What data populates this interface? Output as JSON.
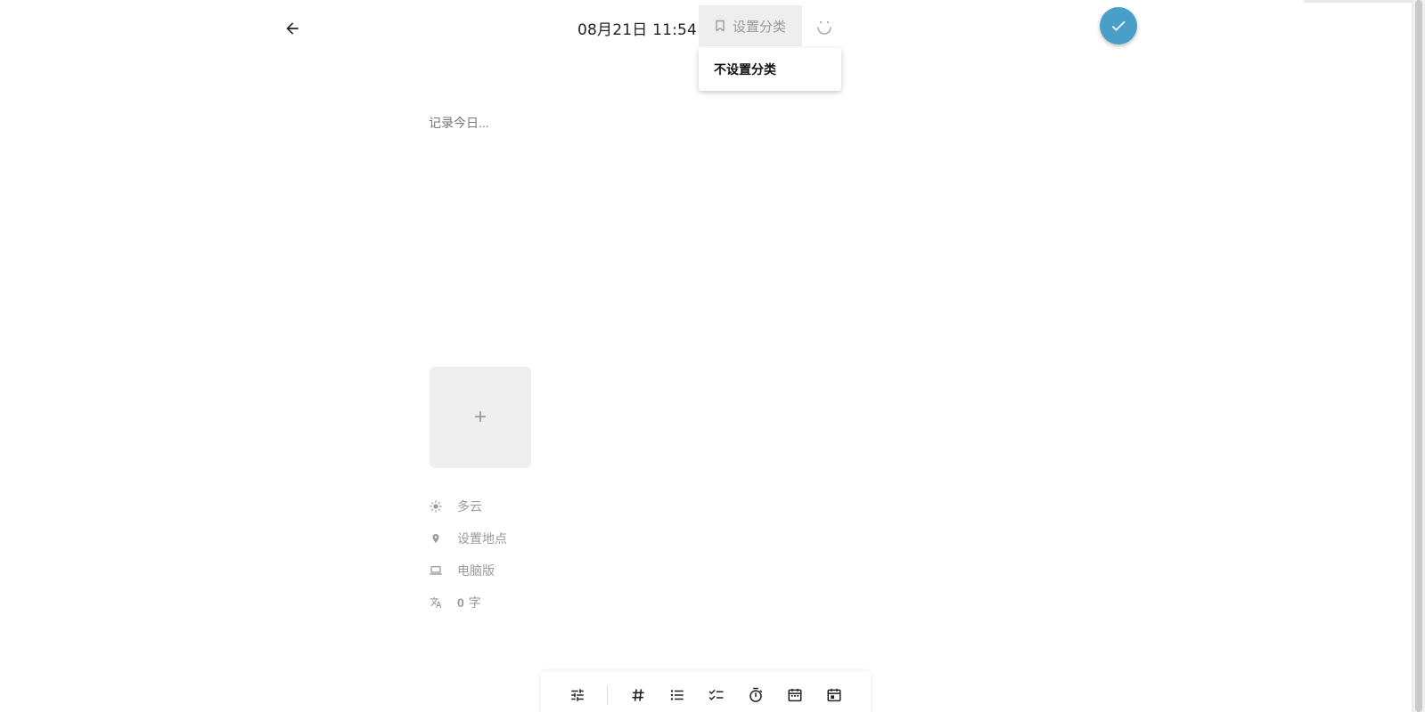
{
  "header": {
    "datetime": "08月21日 11:54",
    "category_label": "设置分类",
    "back_icon": "arrow-left-icon",
    "category_icon": "bookmark-icon",
    "mood_icon": "smile-icon",
    "confirm_icon": "check-icon"
  },
  "category_menu": {
    "items": [
      {
        "label": "不设置分类"
      }
    ]
  },
  "editor": {
    "placeholder": "记录今日..."
  },
  "attachments": {
    "add_label": "+"
  },
  "meta": {
    "weather": {
      "icon": "sun-icon",
      "label": "多云"
    },
    "location": {
      "icon": "location-pin-icon",
      "label": "设置地点"
    },
    "device": {
      "icon": "laptop-icon",
      "label": "电脑版"
    },
    "word_count": {
      "icon": "translate-icon",
      "count": "0",
      "unit": "字"
    }
  },
  "toolbar": {
    "tools": [
      {
        "name": "settings-sliders-icon"
      },
      {
        "name": "hashtag-icon"
      },
      {
        "name": "bulleted-list-icon"
      },
      {
        "name": "checklist-icon"
      },
      {
        "name": "timer-icon"
      },
      {
        "name": "calendar-icon"
      },
      {
        "name": "calendar-today-icon"
      }
    ]
  },
  "colors": {
    "accent": "#4a9fc9",
    "muted_text": "#9a9a9a",
    "button_bg": "#eeeeee"
  }
}
